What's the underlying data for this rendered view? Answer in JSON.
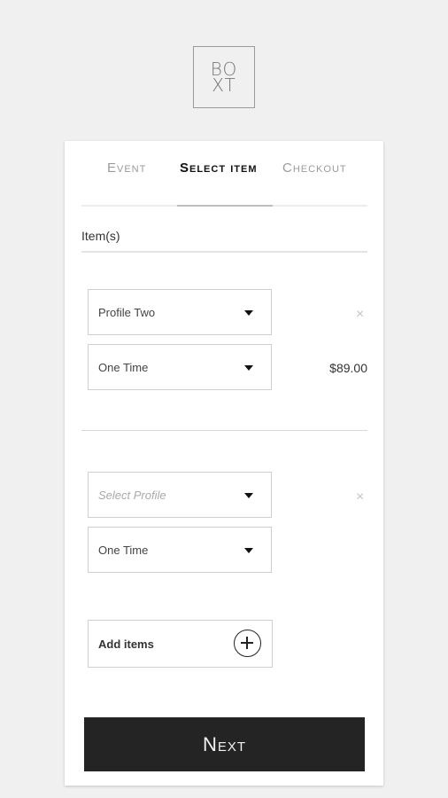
{
  "logo": {
    "line1": "BO",
    "line2": "XT"
  },
  "tabs": {
    "event": "Event",
    "select_item": "Select item",
    "checkout": "Checkout"
  },
  "section": {
    "label": "Item(s)"
  },
  "items": [
    {
      "profile": "Profile Two",
      "frequency": "One Time",
      "price": "$89.00",
      "remove": "×"
    },
    {
      "profile": "Select Profile",
      "frequency": "One Time",
      "price": "",
      "remove": "×"
    }
  ],
  "add_items": {
    "label": "Add items"
  },
  "next_button": {
    "label": "Next"
  }
}
